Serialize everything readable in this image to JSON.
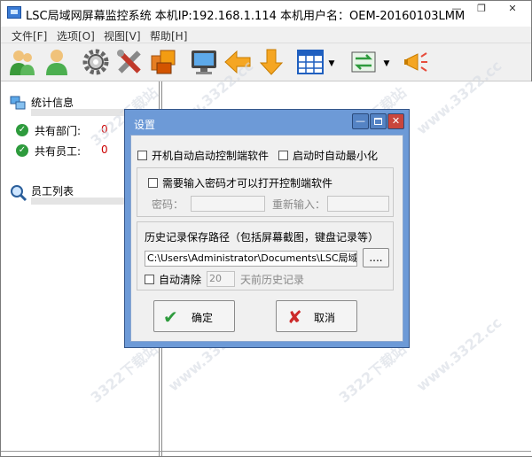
{
  "window": {
    "title": "LSC局域网屏幕监控系统   本机IP:192.168.1.114   本机用户名：OEM-20160103LMM",
    "min_glyph": "—",
    "restore_glyph": "❐",
    "close_glyph": "✕"
  },
  "menu": {
    "items": [
      {
        "label": "文件[F]"
      },
      {
        "label": "选项[O]"
      },
      {
        "label": "视图[V]"
      },
      {
        "label": "帮助[H]"
      }
    ]
  },
  "toolbar": {
    "icons": [
      "users-icon",
      "user-icon",
      "gear-icon",
      "tools-icon",
      "boxes-icon",
      "monitor-icon",
      "arrow-left-icon",
      "arrow-down-icon",
      "grid-icon",
      "transfer-icon",
      "broadcast-icon"
    ],
    "dropdown_glyph": "▼"
  },
  "left_panel": {
    "stats_title": "统计信息",
    "departments_label": "共有部门:",
    "departments_count": "0",
    "employees_label": "共有员工:",
    "employees_count": "0",
    "employees_list_title": "员工列表"
  },
  "dialog": {
    "title": "设置",
    "auto_start_label": "开机自动启动控制端软件",
    "auto_minimize_label": "启动时自动最小化",
    "require_password_label": "需要输入密码才可以打开控制端软件",
    "password_label": "密码：",
    "reenter_label": "重新输入：",
    "history_path_label": "历史记录保存路径（包括屏幕截图，键盘记录等）",
    "history_path_value": "C:\\Users\\Administrator\\Documents\\LSC局域网屏幕",
    "browse_label": "....",
    "auto_clear_label": "自动清除",
    "auto_clear_days": "20",
    "auto_clear_suffix": "天前历史记录",
    "ok_label": "确定",
    "cancel_label": "取消",
    "ok_icon": "✔",
    "cancel_icon": "✘"
  },
  "watermark": {
    "text": "3322下载站",
    "url": "www.3322.cc"
  },
  "colors": {
    "dialog_titlebar": "#6d9ad7",
    "close_button": "#c9463d",
    "count_red": "#cc0000",
    "ok_green": "#2e9b3d",
    "cancel_red": "#cc2a2a"
  }
}
